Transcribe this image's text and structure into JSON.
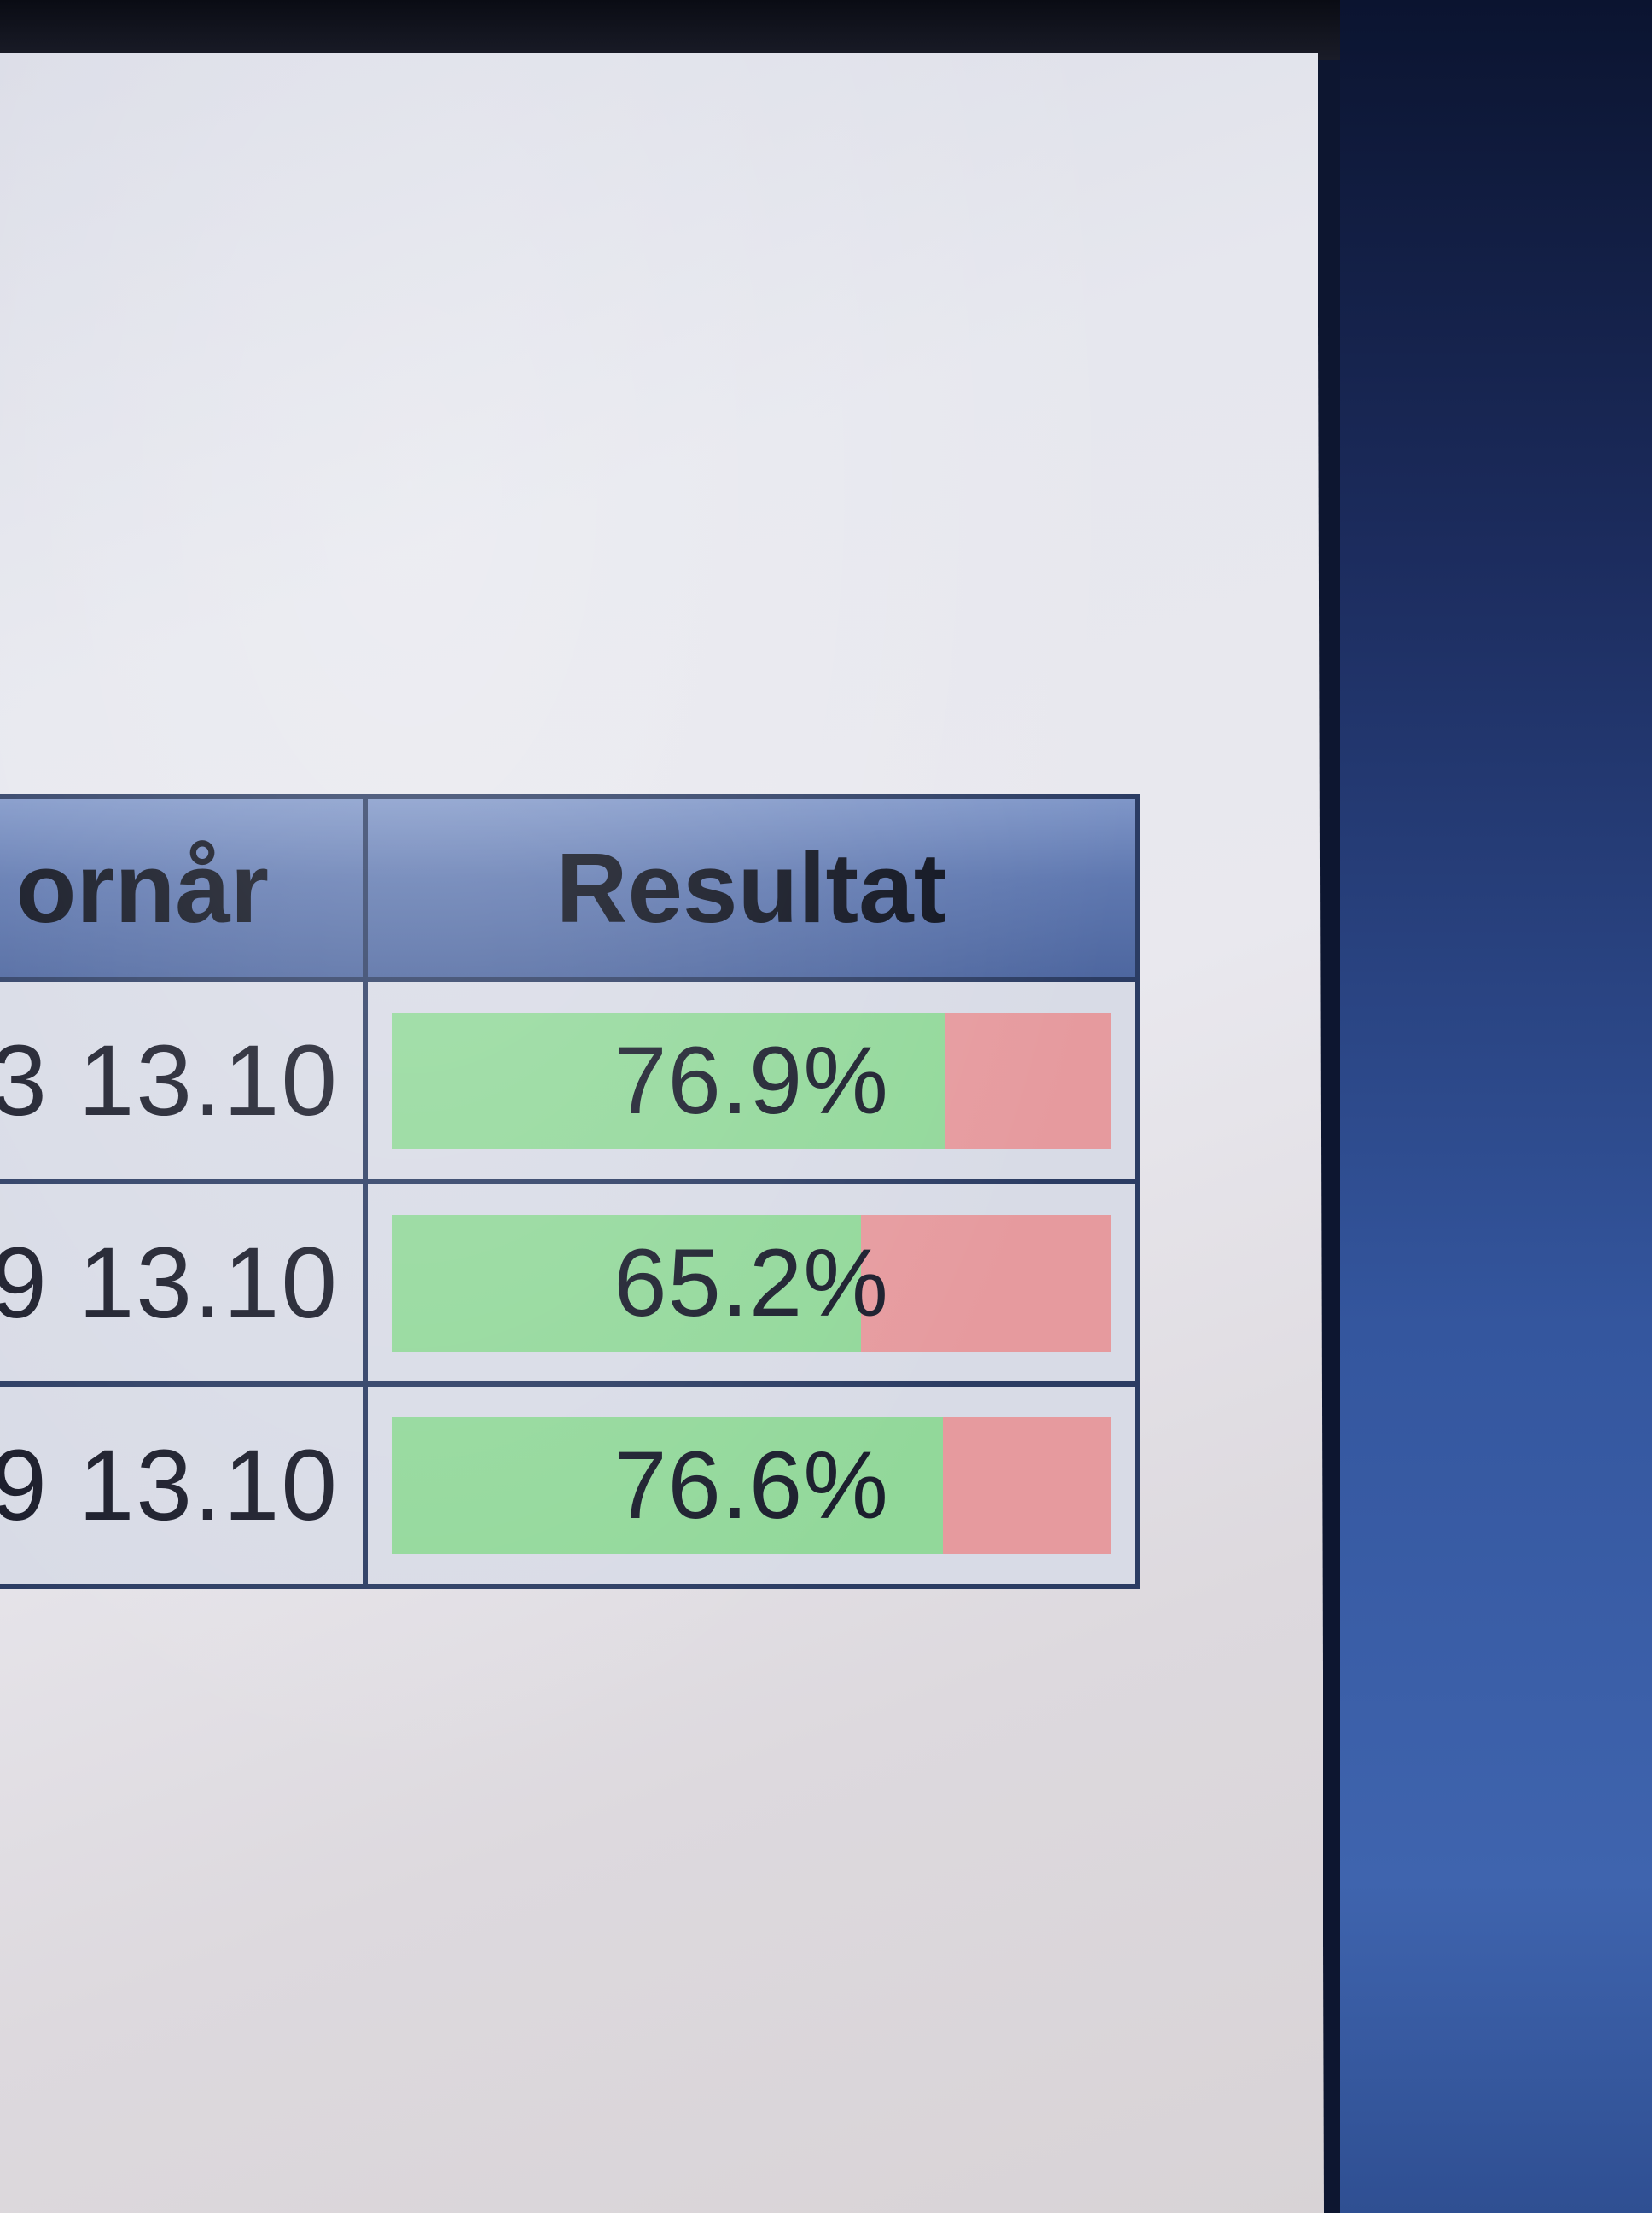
{
  "table": {
    "headers": {
      "date": "ornår",
      "result": "Resultat"
    },
    "rows": [
      {
        "date": "3 13.10",
        "result": "76.9%",
        "result_value": 0.769
      },
      {
        "date": "9 13.10",
        "result": "65.2%",
        "result_value": 0.652
      },
      {
        "date": "9 13.10",
        "result": "76.6%",
        "result_value": 0.766
      }
    ]
  },
  "colors": {
    "header_bg": "#5f78b0",
    "pass_bar": "#92d89a",
    "fail_bar": "#e69a9e",
    "border": "#2b3c63",
    "desktop": "#3f64ae"
  }
}
